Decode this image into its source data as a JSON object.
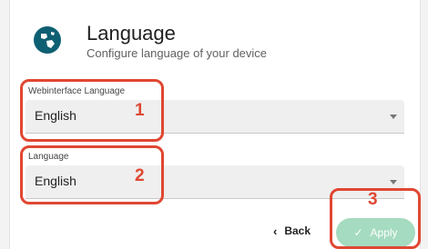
{
  "header": {
    "title": "Language",
    "subtitle": "Configure language of your device",
    "icon": "globe-icon"
  },
  "webinterface_language": {
    "label": "Webinterface Language",
    "value": "English"
  },
  "device_language": {
    "label": "Language",
    "value": "English"
  },
  "actions": {
    "back_label": "Back",
    "apply_label": "Apply"
  },
  "annotations": [
    "1",
    "2",
    "3"
  ],
  "colors": {
    "annotation": "#e04732",
    "apply_button": "#a5dbc0",
    "icon": "#0f5f73"
  }
}
